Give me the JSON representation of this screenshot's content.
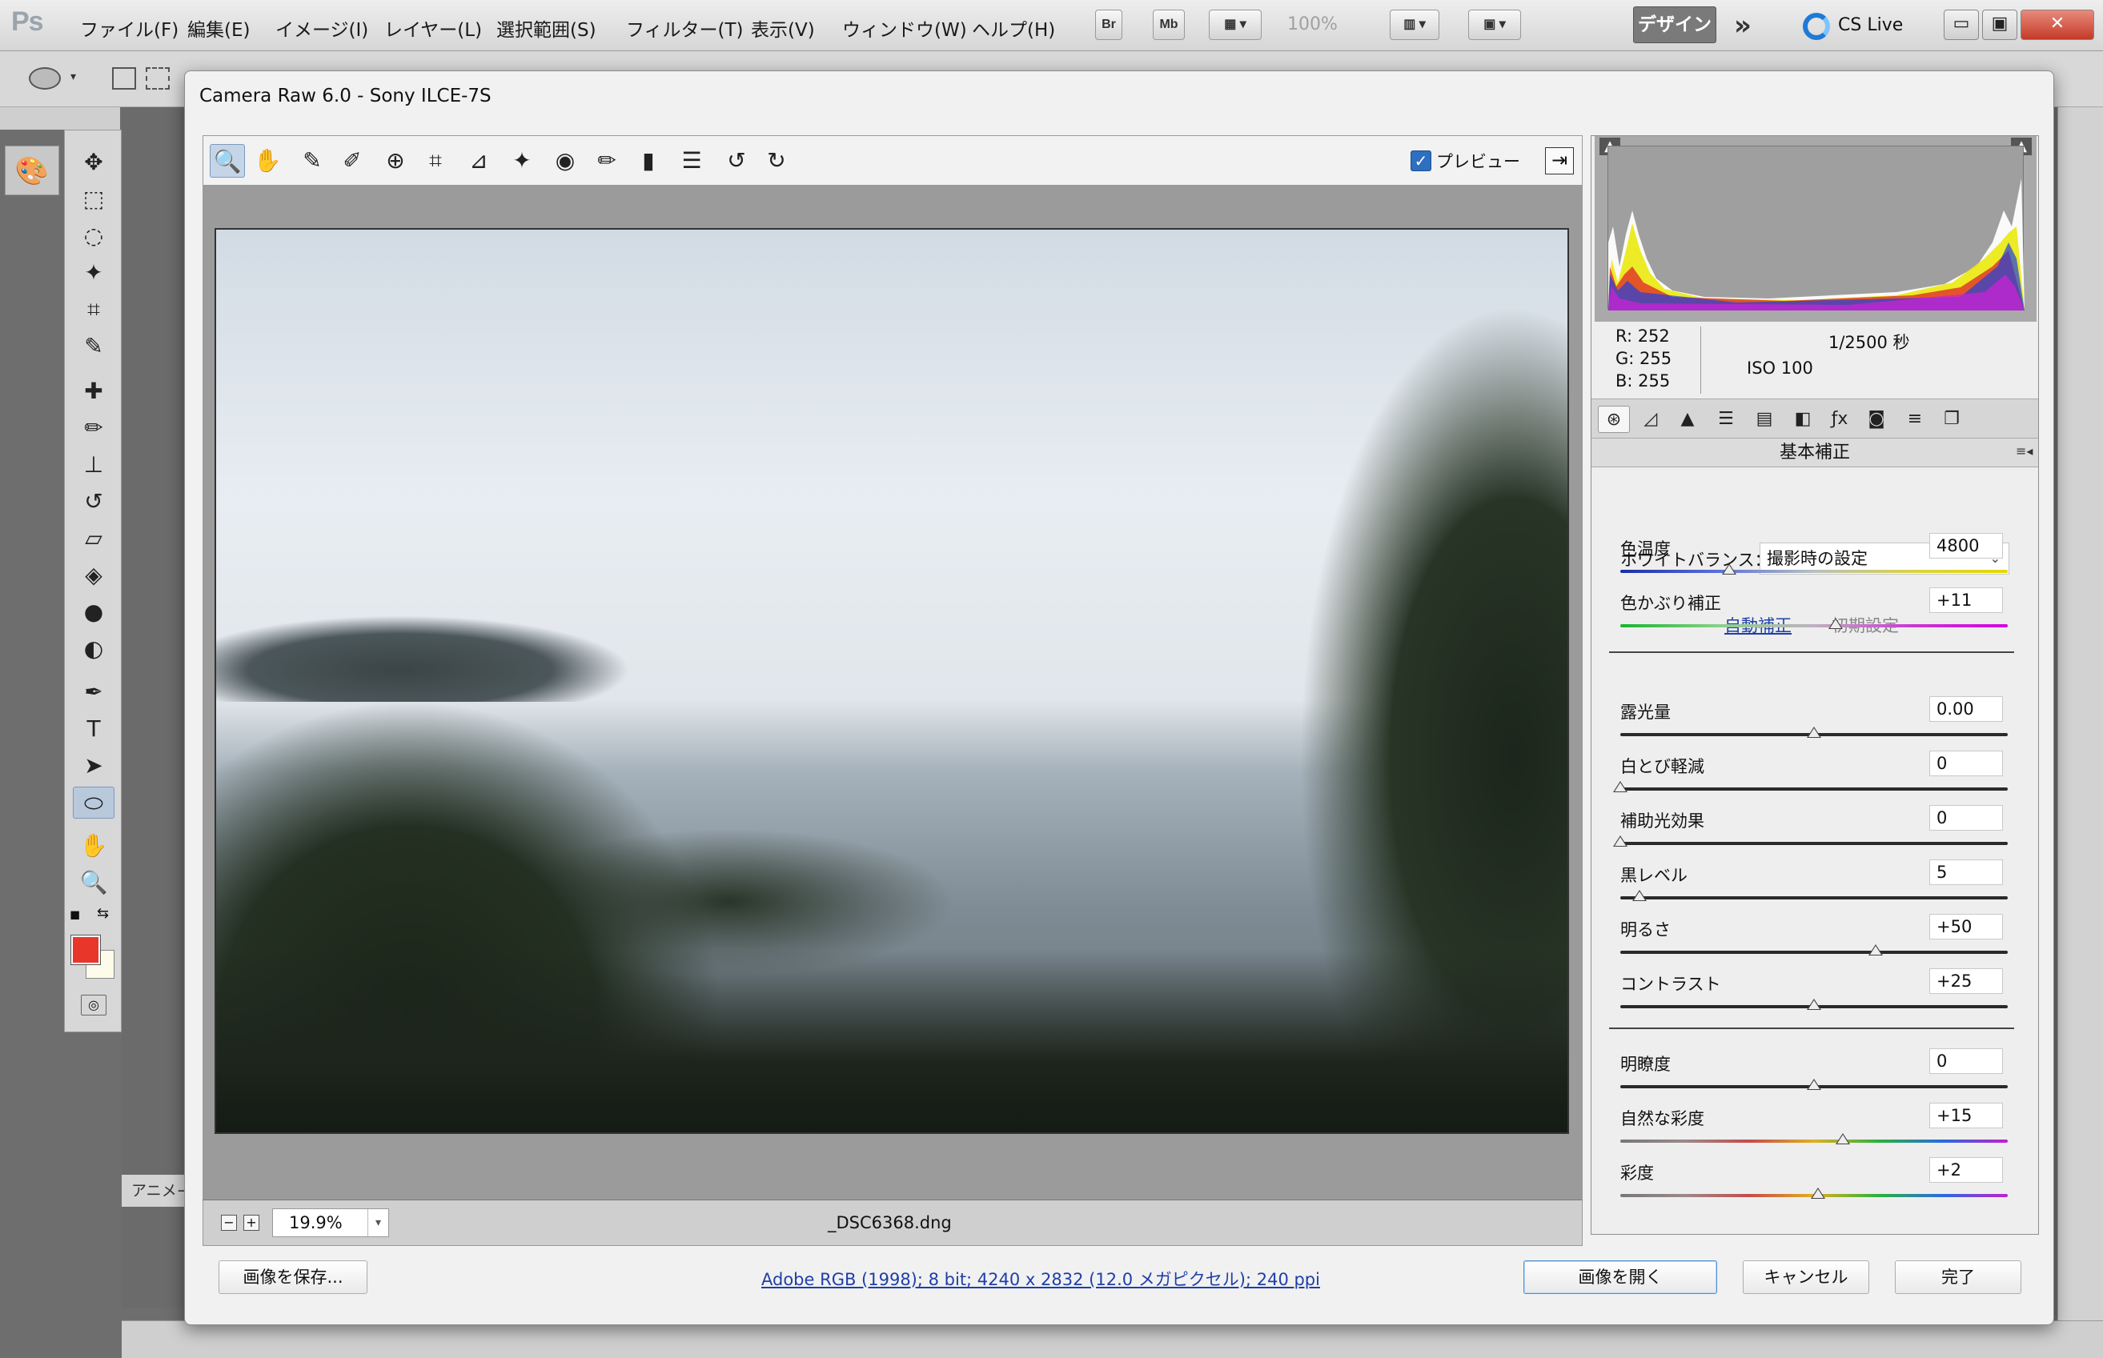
{
  "app": {
    "logo": "Ps",
    "design_label": "デザイン",
    "cs_live": "CS Live",
    "zoom": "100%",
    "panel_tab": "アニメ−"
  },
  "menu": [
    "ファイル(F)",
    "編集(E)",
    "イメージ(I)",
    "レイヤー(L)",
    "選択範囲(S)",
    "フィルター(T)",
    "表示(V)",
    "ウィンドウ(W)",
    "ヘルプ(H)"
  ],
  "bridge": {
    "br": "Br",
    "mb": "Mb"
  },
  "dialog": {
    "title": "Camera Raw 6.0  -  Sony ILCE-7S",
    "preview_label": "プレビュー",
    "preview_checked": true,
    "zoom_value": "19.9%",
    "filename": "_DSC6368.dng",
    "info_link": "Adobe RGB (1998); 8 bit; 4240 x 2832 (12.0 メガピクセル); 240 ppi",
    "buttons": {
      "save": "画像を保存...",
      "open": "画像を開く",
      "cancel": "キャンセル",
      "done": "完了"
    }
  },
  "readout": {
    "r": "R:  252",
    "g": "G:  255",
    "b": "B:  255",
    "shutter": "1/2500 秒",
    "iso": "ISO 100"
  },
  "panel": {
    "section_title": "基本補正",
    "wb_label": "ホワイトバランス：",
    "wb_value": "撮影時の設定",
    "auto_link": "自動補正",
    "default_link": "初期設定",
    "sliders": [
      {
        "label": "色温度",
        "value": "4800",
        "pos": 0.28
      },
      {
        "label": "色かぶり補正",
        "value": "+11",
        "pos": 0.555
      },
      {
        "label": "露光量",
        "value": "0.00",
        "pos": 0.5
      },
      {
        "label": "白とび軽減",
        "value": "0",
        "pos": 0.0
      },
      {
        "label": "補助光効果",
        "value": "0",
        "pos": 0.0
      },
      {
        "label": "黒レベル",
        "value": "5",
        "pos": 0.05
      },
      {
        "label": "明るさ",
        "value": "+50",
        "pos": 0.66
      },
      {
        "label": "コントラスト",
        "value": "+25",
        "pos": 0.5
      },
      {
        "label": "明瞭度",
        "value": "0",
        "pos": 0.5
      },
      {
        "label": "自然な彩度",
        "value": "+15",
        "pos": 0.575
      },
      {
        "label": "彩度",
        "value": "+2",
        "pos": 0.51
      }
    ]
  },
  "colors": {
    "foreground": "#e8362a",
    "background": "#fdfbe9",
    "accent": "#2d6fc0",
    "link": "#1e3fa8"
  }
}
